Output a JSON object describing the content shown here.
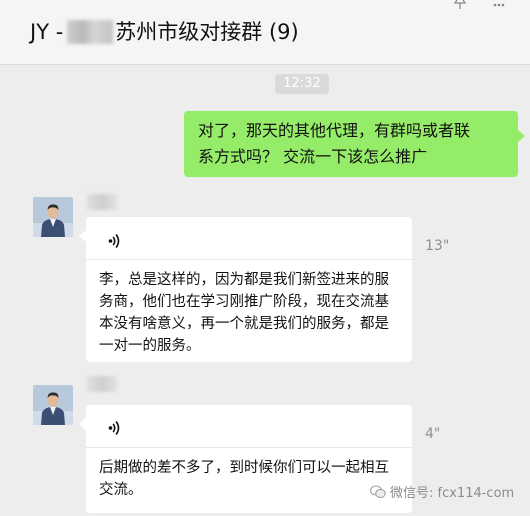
{
  "chat": {
    "title_prefix": "JY -",
    "title_suffix": "苏州市级对接群 (9)"
  },
  "icons": {
    "pin": "pin-icon",
    "more": "more-icon",
    "voice": "voice-icon",
    "watermark": "wechat-icon"
  },
  "timestamp": "12:32",
  "messages": [
    {
      "direction": "outgoing",
      "lines": [
        "对了，那天的其他代理，有群吗或者联",
        "系方式吗？ 交流一下该怎么推广"
      ]
    },
    {
      "direction": "incoming",
      "type": "voice",
      "duration": "13\"",
      "transcript_lines": [
        "李，总是这样的，因为都是我们新签进来的服",
        "务商，他们也在学习刚推广阶段，现在交流基",
        "本没有啥意义，再一个就是我们的服务，都是",
        "一对一的服务。"
      ]
    },
    {
      "direction": "incoming",
      "type": "voice",
      "duration": "4\"",
      "transcript_lines": [
        "后期做的差不多了，到时候你们可以一起相互",
        "交流。"
      ]
    }
  ],
  "watermark": "微信号: fcx114-com",
  "colors": {
    "background": "#ededed",
    "header": "#f5f5f5",
    "outgoing_bubble": "#95ec69",
    "incoming_bubble": "#ffffff",
    "timestamp_badge": "#dadada"
  }
}
